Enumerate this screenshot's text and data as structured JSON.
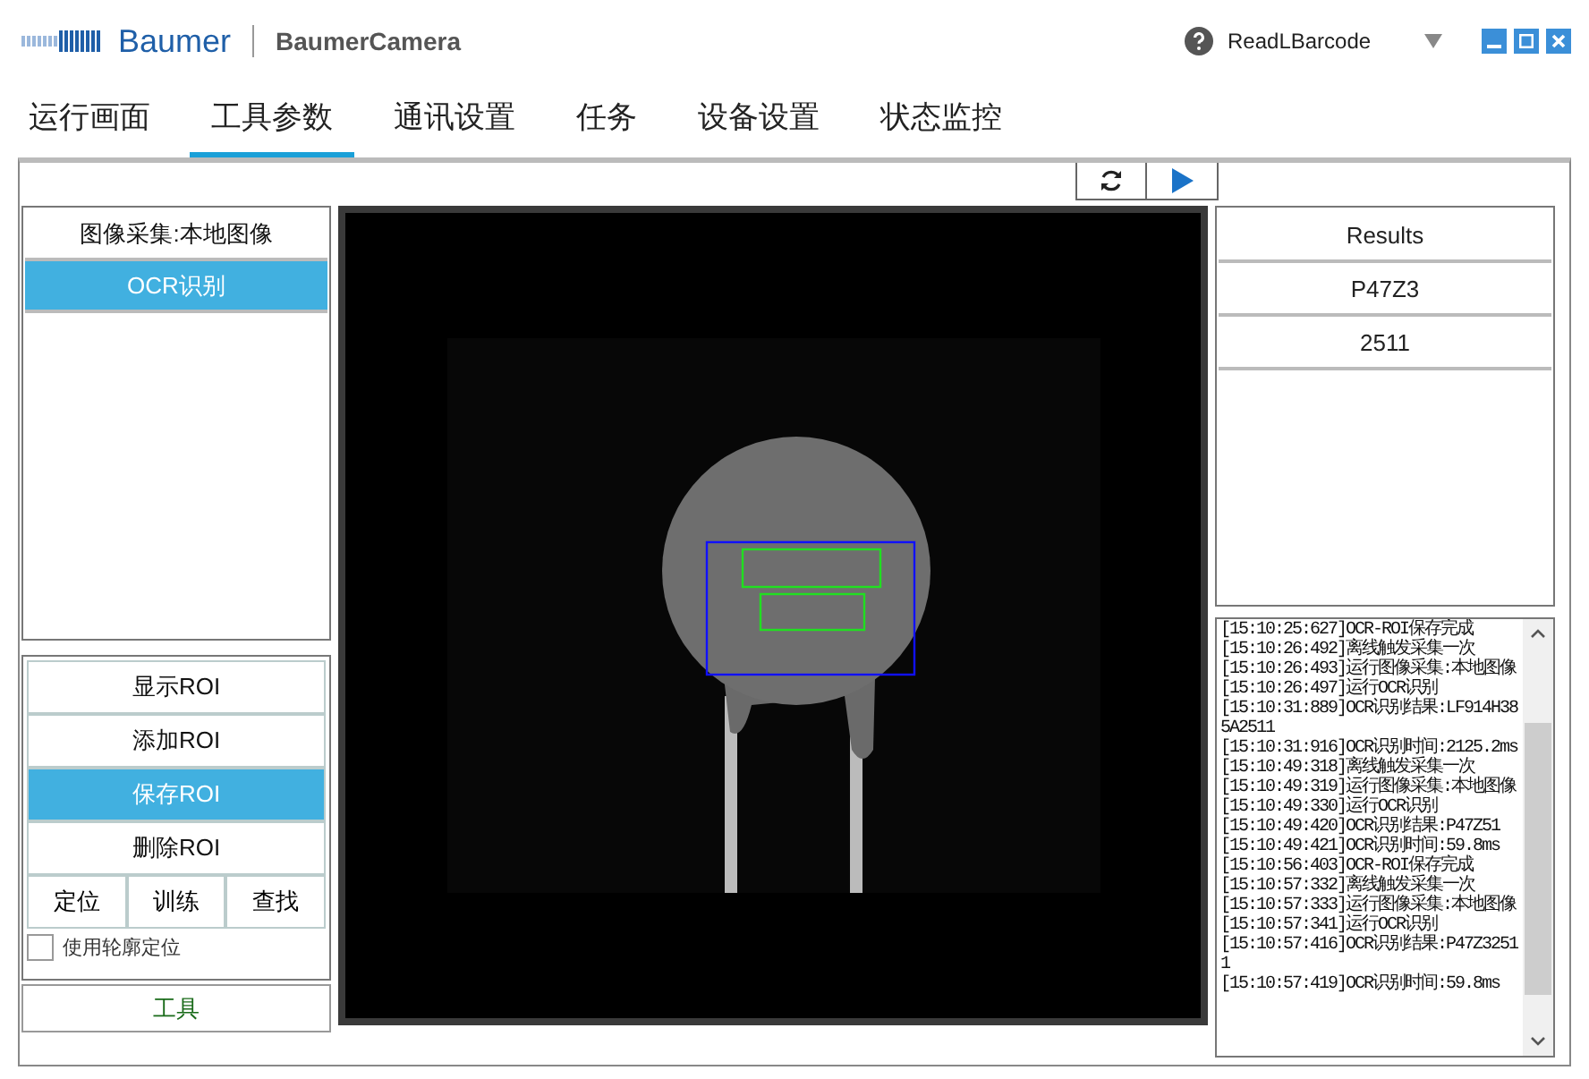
{
  "header": {
    "brand": "Baumer",
    "app_name": "BaumerCamera",
    "job": "ReadLBarcode"
  },
  "tabs": [
    {
      "label": "运行画面",
      "selected": false
    },
    {
      "label": "工具参数",
      "selected": true
    },
    {
      "label": "通讯设置",
      "selected": false
    },
    {
      "label": "任务",
      "selected": false
    },
    {
      "label": "设备设置",
      "selected": false
    },
    {
      "label": "状态监控",
      "selected": false
    }
  ],
  "tool_list": [
    {
      "label": "图像采集:本地图像",
      "selected": false
    },
    {
      "label": "OCR识别",
      "selected": true
    }
  ],
  "roi_buttons": [
    {
      "label": "显示ROI",
      "selected": false
    },
    {
      "label": "添加ROI",
      "selected": false
    },
    {
      "label": "保存ROI",
      "selected": true
    },
    {
      "label": "删除ROI",
      "selected": false
    }
  ],
  "action_buttons": [
    "定位",
    "训练",
    "查找"
  ],
  "contour_checkbox": {
    "label": "使用轮廓定位",
    "checked": false
  },
  "tool_button": "工具",
  "results": {
    "header": "Results",
    "rows": [
      "P47Z3",
      "2511"
    ]
  },
  "log": [
    "[15:10:25:627]OCR-ROI保存完成",
    "[15:10:26:492]离线触发采集一次",
    "[15:10:26:493]运行图像采集:本地图像",
    "[15:10:26:497]运行OCR识别",
    "[15:10:31:889]OCR识别结果:LF914H385A2511",
    "[15:10:31:916]OCR识别时间:2125.2ms",
    "[15:10:49:318]离线触发采集一次",
    "[15:10:49:319]运行图像采集:本地图像",
    "[15:10:49:330]运行OCR识别",
    "[15:10:49:420]OCR识别结果:P47Z51",
    "[15:10:49:421]OCR识别时间:59.8ms",
    "[15:10:56:403]OCR-ROI保存完成",
    "[15:10:57:332]离线触发采集一次",
    "[15:10:57:333]运行图像采集:本地图像",
    "[15:10:57:341]运行OCR识别",
    "[15:10:57:416]OCR识别结果:P47Z32511",
    "[15:10:57:419]OCR识别时间:59.8ms"
  ]
}
